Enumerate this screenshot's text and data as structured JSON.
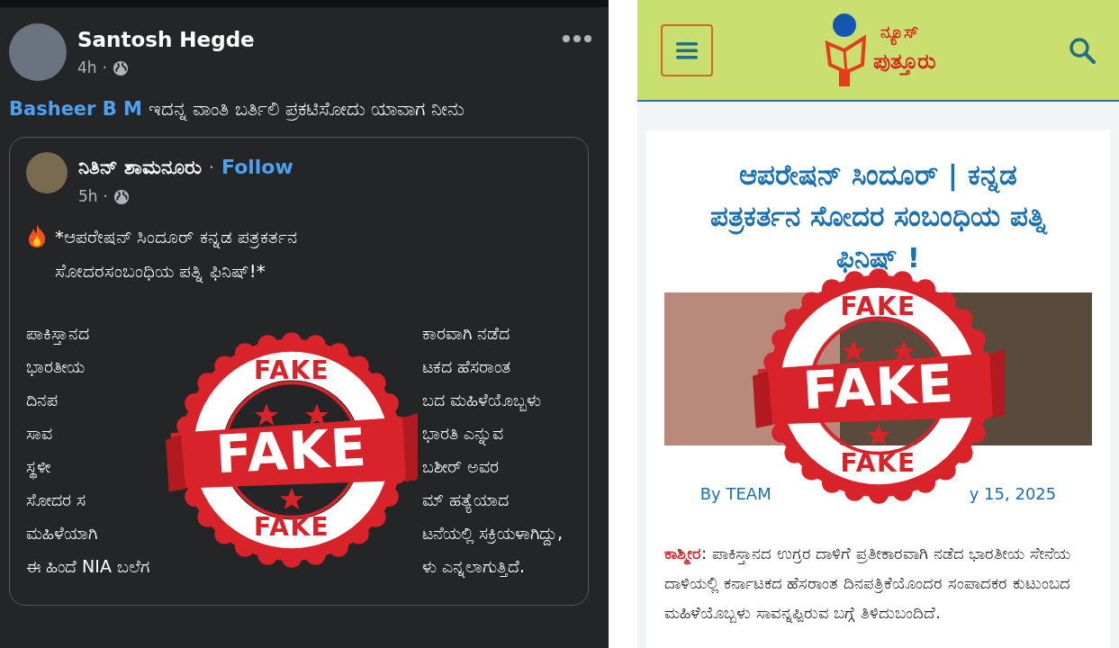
{
  "facebook_post": {
    "author": "Santosh Hegde",
    "time": "4h",
    "time_separator": "·",
    "mention": "Basheer B M",
    "text": "ಇದನ್ನ ವಾಂತಿ ಬರ್ತಿಲಿ ಪ್ರಕಟಿಸೋದು ಯಾವಾಗ ನೀನು",
    "shared_post": {
      "author": "ನಿತಿನ್ ಶಾಮನೂರು",
      "separator": "·",
      "follow": "Follow",
      "time": "5h",
      "time_separator": "·",
      "headline_lines": [
        "*ಆಪರೇಷನ್ ಸಿಂದೂರ್ ಕನ್ನಡ ಪತ್ರಕರ್ತನ",
        "ಸೋದರಸಂಬಂಧಿಯ ಪತ್ನಿ ಫಿನಿಷ್!*"
      ],
      "body_lines": [
        {
          "left": "ಪಾಕಿಸ್ತಾನದ",
          "right": "ಕಾರವಾಗಿ ನಡೆದ"
        },
        {
          "left": "ಭಾರತೀಯ",
          "right": "ಟಕದ ಹೆಸರಾಂತ"
        },
        {
          "left": "ದಿನಪ",
          "right": "ಬದ ಮಹಿಳೆಯೊಬ್ಬಳು"
        },
        {
          "left": "ಸಾವ",
          "right": "ಭಾರತಿ ಎನ್ನುವ"
        },
        {
          "left": "ಸ್ಥಳೀ",
          "right": "ಬಶೀರ್ ಅವರ"
        },
        {
          "left": "ಸೋದರ ಸ",
          "right": "ಮ್ ಹತ್ಯೆಯಾದ"
        },
        {
          "left": "ಮಹಿಳೆಯಾಗಿ",
          "right": "ಟನೆಯಲ್ಲಿ ಸಕ್ರಿಯಳಾಗಿದ್ದು,"
        },
        {
          "left": "ಈ ಹಿಂದೆ NIA ಬಲೆಗ",
          "right": "ಳು ಎನ್ನಲಾಗುತ್ತಿದೆ."
        }
      ]
    },
    "stamp": {
      "top": "FAKE",
      "main": "FAKE",
      "bottom": "FAKE"
    }
  },
  "news_site": {
    "logo_lines": [
      "ನ್ಯೂಸ್",
      "ಪುತ್ತೂರು"
    ],
    "title": "ಆಪರೇಷನ್ ಸಿಂದೂರ್ | ಕನ್ನಡ ಪತ್ರಕರ್ತನ ಸೋದರ ಸಂಬಂಧಿಯ ಪತ್ನಿ ಫಿನಿಷ್ !",
    "byline_left": "By TEAM",
    "byline_right": "y 15, 2025",
    "dateline": "ಕಾಶ್ಮೀರ",
    "body": ": ಪಾಕಿಸ್ತಾನದ ಉಗ್ರರ ದಾಳಿಗೆ ಪ್ರತೀಕಾರವಾಗಿ ನಡೆದ ಭಾರತೀಯ ಸೇನೆಯ ದಾಳಿಯಲ್ಲಿ ಕರ್ನಾಟಕದ ಹೆಸರಾಂತ ದಿನಪತ್ರಿಕೆಯೊಂದರ ಸಂಪಾದಕರ ಕುಟುಂಬದ ಮಹಿಳೆಯೊಬ್ಬಳು ಸಾವನ್ನಪ್ಪಿರುವ ಬಗ್ಗೆ ತಿಳಿದುಬಂದಿದೆ.",
    "stamp": {
      "top": "FAKE",
      "main": "FAKE",
      "bottom": "FAKE"
    }
  }
}
